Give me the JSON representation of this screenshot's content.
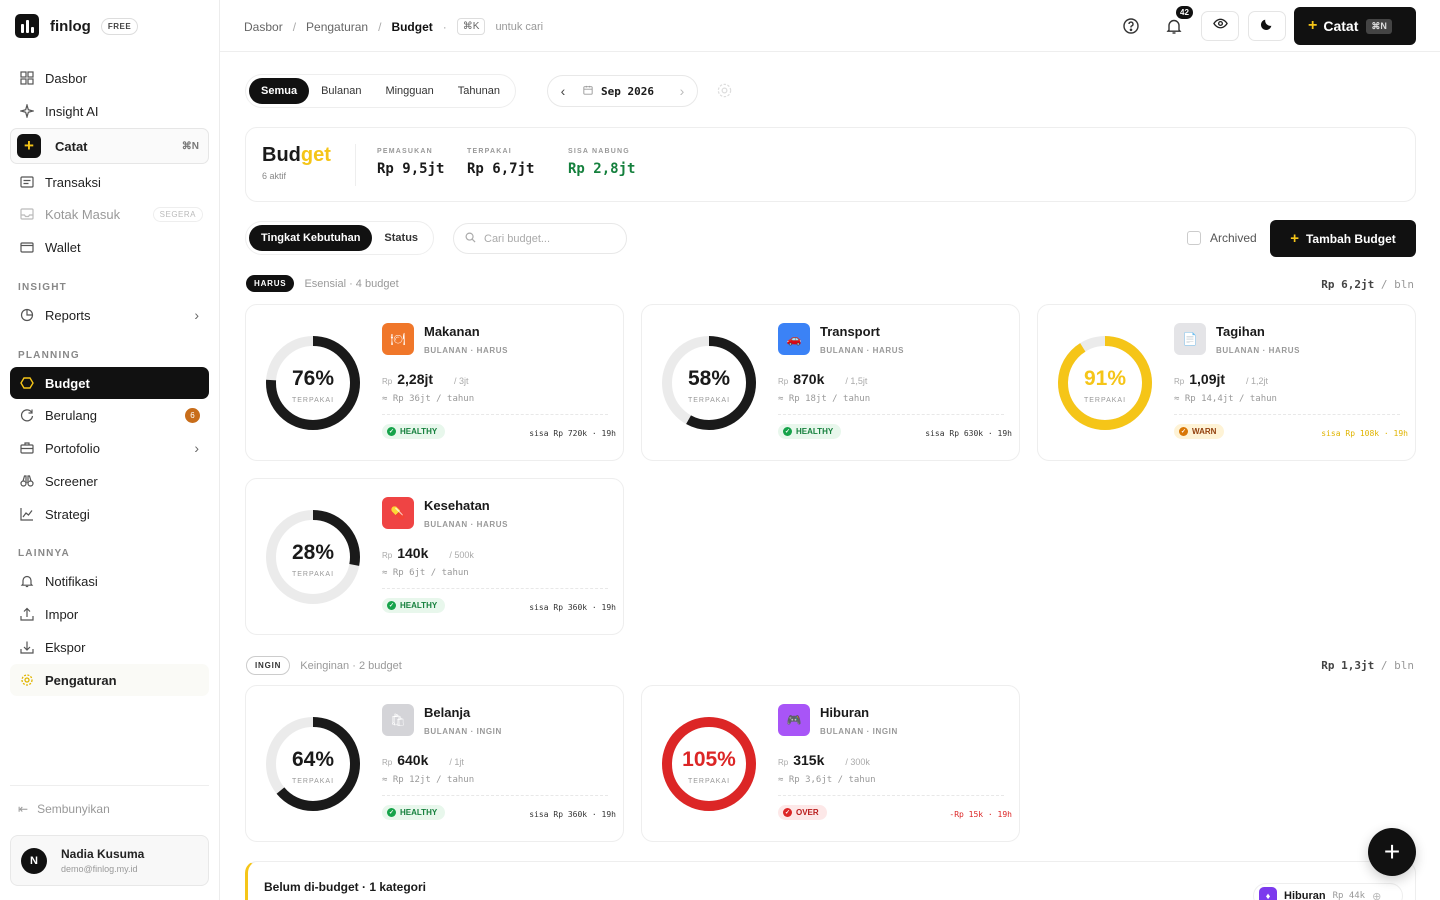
{
  "app": {
    "name": "finlog",
    "plan": "FREE"
  },
  "sidebar": {
    "items": [
      {
        "label": "Dasbor"
      },
      {
        "label": "Insight AI"
      },
      {
        "label": "Catat",
        "shortcut": "⌘N"
      },
      {
        "label": "Transaksi"
      },
      {
        "label": "Kotak Masuk",
        "badge": "SEGERA"
      },
      {
        "label": "Wallet"
      }
    ],
    "section_insight": "INSIGHT",
    "reports": "Reports",
    "section_planning": "PLANNING",
    "planning": [
      {
        "label": "Budget"
      },
      {
        "label": "Berulang",
        "badge": "6"
      },
      {
        "label": "Portofolio"
      },
      {
        "label": "Screener"
      },
      {
        "label": "Strategi"
      }
    ],
    "section_lainnya": "LAINNYA",
    "lainnya": [
      {
        "label": "Notifikasi"
      },
      {
        "label": "Impor"
      },
      {
        "label": "Ekspor"
      },
      {
        "label": "Pengaturan"
      }
    ],
    "hide": "Sembunyikan",
    "user": {
      "initial": "N",
      "name": "Nadia Kusuma",
      "email": "demo@finlog.my.id"
    }
  },
  "topbar": {
    "breadcrumb": [
      "Dasbor",
      "Pengaturan",
      "Budget"
    ],
    "search_key": "⌘K",
    "search_hint": "untuk cari",
    "notif_count": "42",
    "catat_label": "Catat",
    "catat_key": "⌘N"
  },
  "filters": {
    "period_tabs": [
      "Semua",
      "Bulanan",
      "Mingguan",
      "Tahunan"
    ],
    "active_tab": "Semua",
    "month": "Sep 2026",
    "group_tabs": [
      "Tingkat Kebutuhan",
      "Status"
    ],
    "search_placeholder": "Cari budget...",
    "archived_label": "Archived",
    "add_label": "Tambah Budget"
  },
  "summary": {
    "title_a": "Bud",
    "title_b": "get",
    "subtitle": "6 aktif",
    "income_label": "PEMASUKAN",
    "income": "Rp 9,5jt",
    "spent_label": "TERPAKAI",
    "spent": "Rp 6,7jt",
    "save_label": "SISA NABUNG",
    "save": "Rp 2,8jt"
  },
  "groups": [
    {
      "tag": "HARUS",
      "desc": "Esensial · 4 budget",
      "amount": "Rp 6,2jt",
      "per": " / bln"
    },
    {
      "tag": "INGIN",
      "desc": "Keinginan · 2 budget",
      "amount": "Rp 1,3jt",
      "per": " / bln"
    }
  ],
  "budgets": [
    {
      "name": "Makanan",
      "meta": "BULANAN · HARUS",
      "pct": "76%",
      "pct_value": 76,
      "pct_label": "TERPAKAI",
      "rp": "Rp",
      "spent": "2,28jt",
      "limit": "/ 3jt",
      "yearly": "≈ Rp 36jt / tahun",
      "status": "HEALTHY",
      "remaining": "sisa Rp 720k · 19h",
      "ring_color": "#1a1a1a",
      "icon_bg": "#f0772a",
      "icon": "food-icon"
    },
    {
      "name": "Transport",
      "meta": "BULANAN · HARUS",
      "pct": "58%",
      "pct_value": 58,
      "pct_label": "TERPAKAI",
      "rp": "Rp",
      "spent": "870k",
      "limit": "/ 1,5jt",
      "yearly": "≈ Rp 18jt / tahun",
      "status": "HEALTHY",
      "remaining": "sisa Rp 630k · 19h",
      "ring_color": "#1a1a1a",
      "icon_bg": "#3b82f6",
      "icon": "car-icon"
    },
    {
      "name": "Tagihan",
      "meta": "BULANAN · HARUS",
      "pct": "91%",
      "pct_value": 91,
      "pct_label": "TERPAKAI",
      "rp": "Rp",
      "spent": "1,09jt",
      "limit": "/ 1,2jt",
      "yearly": "≈ Rp 14,4jt / tahun",
      "status": "WARN",
      "remaining": "sisa Rp 108k · 19h",
      "ring_color": "#f5c518",
      "icon_bg": "#e4e4e7",
      "icon": "bill-icon"
    },
    {
      "name": "Kesehatan",
      "meta": "BULANAN · HARUS",
      "pct": "28%",
      "pct_value": 28,
      "pct_label": "TERPAKAI",
      "rp": "Rp",
      "spent": "140k",
      "limit": "/ 500k",
      "yearly": "≈ Rp 6jt / tahun",
      "status": "HEALTHY",
      "remaining": "sisa Rp 360k · 19h",
      "ring_color": "#1a1a1a",
      "icon_bg": "#ef4444",
      "icon": "health-icon"
    },
    {
      "name": "Belanja",
      "meta": "BULANAN · INGIN",
      "pct": "64%",
      "pct_value": 64,
      "pct_label": "TERPAKAI",
      "rp": "Rp",
      "spent": "640k",
      "limit": "/ 1jt",
      "yearly": "≈ Rp 12jt / tahun",
      "status": "HEALTHY",
      "remaining": "sisa Rp 360k · 19h",
      "ring_color": "#1a1a1a",
      "icon_bg": "#d4d4d8",
      "icon": "shopping-icon"
    },
    {
      "name": "Hiburan",
      "meta": "BULANAN · INGIN",
      "pct": "105%",
      "pct_value": 105,
      "pct_label": "TERPAKAI",
      "rp": "Rp",
      "spent": "315k",
      "limit": "/ 300k",
      "yearly": "≈ Rp 3,6jt / tahun",
      "status": "OVER",
      "remaining": "-Rp 15k · 19h",
      "ring_color": "#dc2626",
      "icon_bg": "#a855f7",
      "icon": "entertainment-icon"
    }
  ],
  "unbudgeted": {
    "title": "Belum di-budget · 1 kategori",
    "chip_name": "Hiburan",
    "chip_amount": "Rp 44k"
  },
  "colors": {
    "accent": "#f5c518",
    "healthy": "#16a34a",
    "warn": "#b45309",
    "over": "#dc2626"
  }
}
